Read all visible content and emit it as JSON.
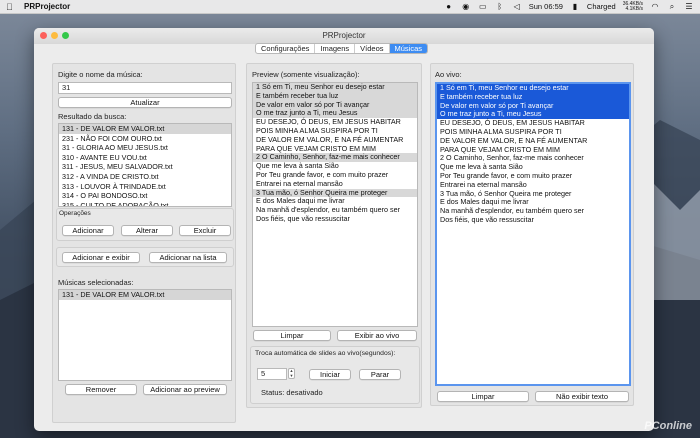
{
  "menubar": {
    "app_name": "PRProjector",
    "clock": "Sun 06:59",
    "battery": "Charged",
    "net_up": "36.4KB/s",
    "net_down": "4.1KB/s"
  },
  "window": {
    "title": "PRProjector",
    "tabs": [
      {
        "label": "Configurações",
        "active": false
      },
      {
        "label": "Imagens",
        "active": false
      },
      {
        "label": "Vídeos",
        "active": false
      },
      {
        "label": "Músicas",
        "active": true
      }
    ]
  },
  "left": {
    "search_label": "Digite o nome da música:",
    "search_value": "31",
    "refresh_label": "Atualizar",
    "results_label": "Resultado da busca:",
    "results": [
      "131 - DE VALOR EM VALOR.txt",
      "231 - NÃO FOI COM OURO.txt",
      "31 - GLORIA AO MEU JESUS.txt",
      "310 - AVANTE EU VOU.txt",
      "311 - JESUS, MEU SALVADOR.txt",
      "312 - A VINDA DE CRISTO.txt",
      "313 - LOUVOR À TRINDADE.txt",
      "314 - O PAI BONDOSO.txt",
      "315 - CULTO DE ADORAÇÃO.txt"
    ],
    "operations_label": "Operações",
    "add_label": "Adicionar",
    "edit_label": "Alterar",
    "delete_label": "Excluir",
    "add_show_label": "Adicionar e exibir",
    "add_list_label": "Adicionar na lista",
    "selected_label": "Músicas selecionadas:",
    "selected": [
      "131 - DE VALOR EM VALOR.txt"
    ],
    "remove_label": "Remover",
    "add_preview_label": "Adicionar ao preview"
  },
  "preview": {
    "label": "Preview (somente visualização):",
    "lines": [
      {
        "text": "1 Só em Ti, meu Senhor eu desejo estar",
        "hl": true
      },
      {
        "text": "E também receber tua luz",
        "hl": true
      },
      {
        "text": "De valor em valor só por Ti avançar",
        "hl": true
      },
      {
        "text": "O me traz junto a Ti, meu Jesus",
        "hl": true
      },
      {
        "text": "EU DESEJO, Ó DEUS, EM JESUS HABITAR",
        "hl": false
      },
      {
        "text": "POIS MINHA ALMA SUSPIRA POR TI",
        "hl": false
      },
      {
        "text": "DE VALOR EM VALOR, E NA FÉ AUMENTAR",
        "hl": false
      },
      {
        "text": "PARA QUE VEJAM CRISTO EM MIM",
        "hl": false
      },
      {
        "text": "2 O Caminho, Senhor, faz-me mais conhecer",
        "hl": true
      },
      {
        "text": "Que me leva à santa Sião",
        "hl": false
      },
      {
        "text": "Por Teu grande favor, e com muito prazer",
        "hl": false
      },
      {
        "text": "Entrarei na eternal mansão",
        "hl": false
      },
      {
        "text": "3 Tua mão, ó Senhor Queira me proteger",
        "hl": true
      },
      {
        "text": "E dos Males daqui me livrar",
        "hl": false
      },
      {
        "text": "Na manhã d'esplendor, eu também quero ser",
        "hl": false
      },
      {
        "text": "Dos fiéis, que vão ressuscitar",
        "hl": false
      }
    ],
    "clear_label": "Limpar",
    "show_live_label": "Exibir ao vivo",
    "auto_label": "Troca automática de slides ao vivo(segundos):",
    "interval_value": "5",
    "start_label": "Iniciar",
    "stop_label": "Parar",
    "status_text": "Status: desativado"
  },
  "live": {
    "label": "Ao vivo:",
    "lines": [
      {
        "text": "1 Só em Ti, meu Senhor eu desejo estar",
        "sel": true
      },
      {
        "text": "E também receber tua luz",
        "sel": true
      },
      {
        "text": "De valor em valor só por Ti avançar",
        "sel": true
      },
      {
        "text": "O me traz junto a Ti, meu Jesus",
        "sel": true
      },
      {
        "text": "EU DESEJO, Ó DEUS, EM JESUS HABITAR",
        "sel": false
      },
      {
        "text": "POIS MINHA ALMA SUSPIRA POR TI",
        "sel": false
      },
      {
        "text": "DE VALOR EM VALOR, E NA FÉ AUMENTAR",
        "sel": false
      },
      {
        "text": "PARA QUE VEJAM CRISTO EM MIM",
        "sel": false
      },
      {
        "text": "2 O Caminho, Senhor, faz-me mais conhecer",
        "sel": false
      },
      {
        "text": "Que me leva à santa Sião",
        "sel": false
      },
      {
        "text": "Por Teu grande favor, e com muito prazer",
        "sel": false
      },
      {
        "text": "Entrarei na eternal mansão",
        "sel": false
      },
      {
        "text": "3 Tua mão, ó Senhor Queira me proteger",
        "sel": false
      },
      {
        "text": "E dos Males daqui me livrar",
        "sel": false
      },
      {
        "text": "Na manhã d'esplendor, eu também quero ser",
        "sel": false
      },
      {
        "text": "Dos fiéis, que vão ressuscitar",
        "sel": false
      }
    ],
    "clear_label": "Limpar",
    "hide_text_label": "Não exibir texto"
  },
  "watermark": "PConline"
}
